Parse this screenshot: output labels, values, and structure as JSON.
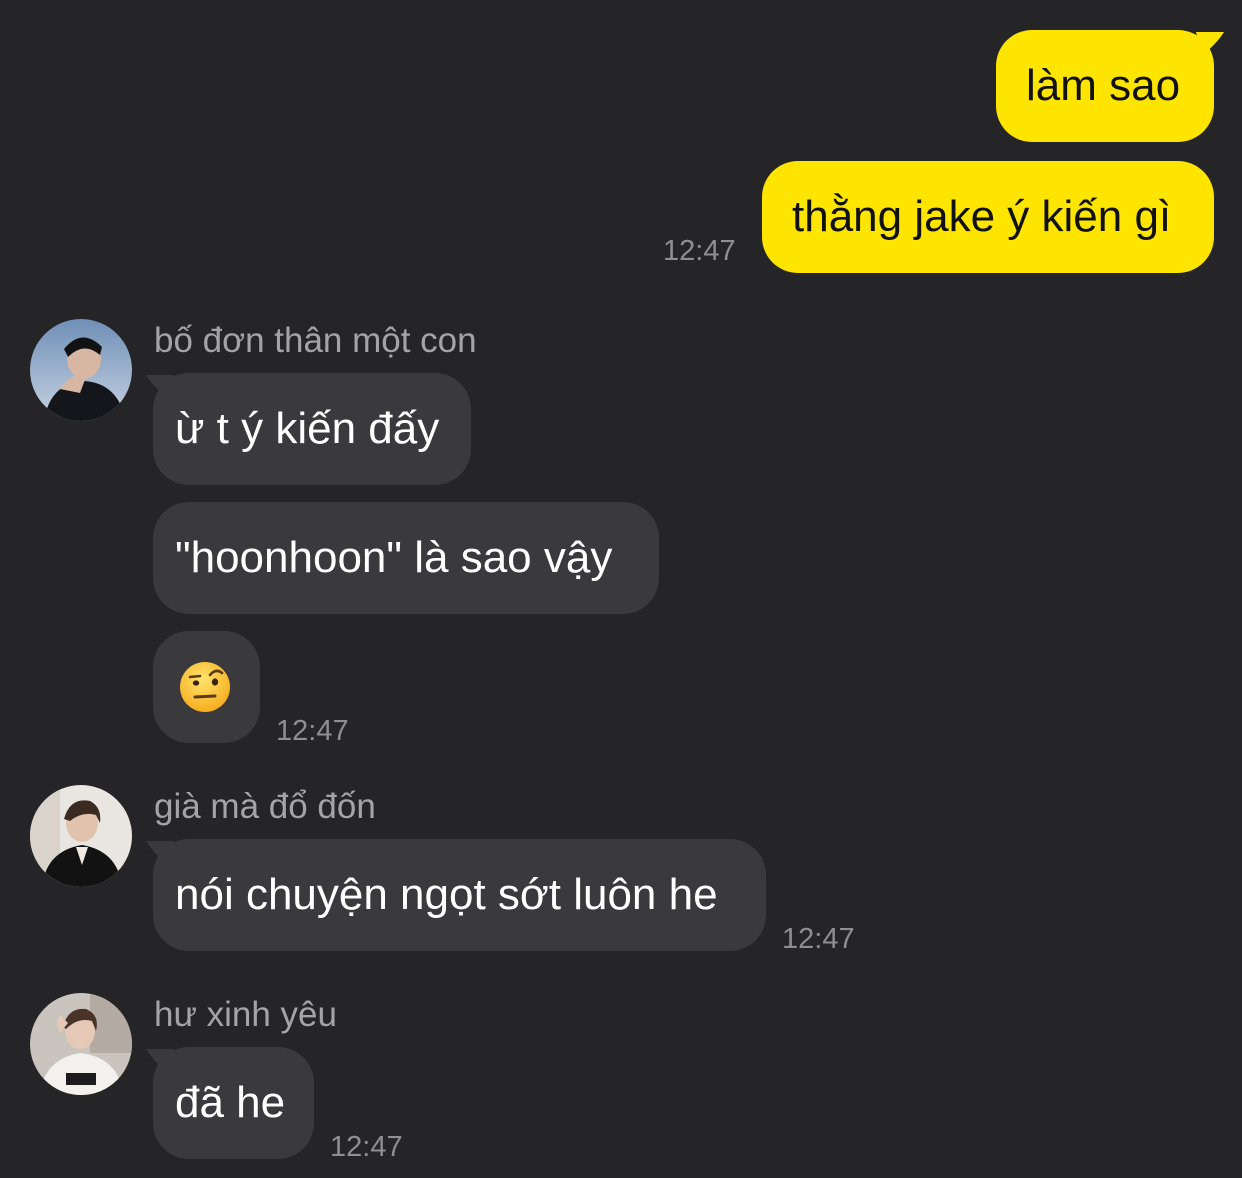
{
  "outgoing": [
    {
      "text": "làm sao"
    },
    {
      "text": "thằng jake ý kiến gì",
      "time": "12:47"
    }
  ],
  "groups": [
    {
      "sender": "bố đơn thân một con",
      "messages": [
        {
          "text": "ừ t ý kiến đấy"
        },
        {
          "text": "\"hoonhoon\" là sao vậy"
        },
        {
          "emoji": "face-with-raised-eyebrow-emoji"
        }
      ],
      "time": "12:47"
    },
    {
      "sender": "già mà đổ đốn",
      "messages": [
        {
          "text": "nói chuyện ngọt sớt luôn he"
        }
      ],
      "time": "12:47"
    },
    {
      "sender": "hư xinh yêu",
      "messages": [
        {
          "text": "đã he"
        }
      ],
      "time": "12:47"
    }
  ],
  "colors": {
    "background": "#252527",
    "outgoing_bubble": "#fee500",
    "incoming_bubble": "#3a3a3c",
    "timestamp": "#8e8e93",
    "sender_name": "#a4a4a8"
  }
}
